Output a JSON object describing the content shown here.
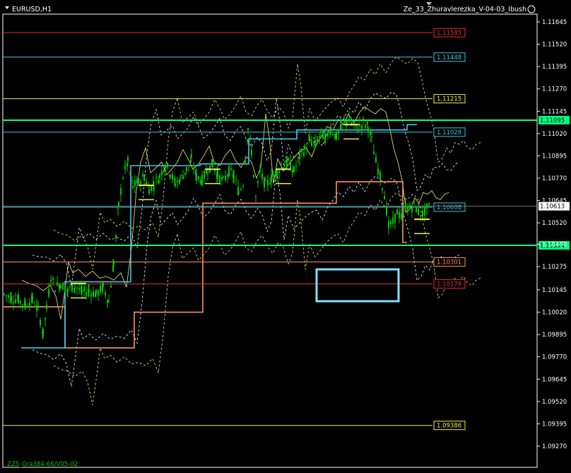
{
  "window": {
    "symbol_title": "EURUSD,H1",
    "indicator_title": "Ze_33_Zhuravlerezka_V-04-03_Ibush",
    "bottom_label": "ZZ5_Gra384-66/V05-02"
  },
  "colors": {
    "background": "#000000",
    "axis": "#ffffff",
    "candle": "#00c800",
    "red_level": "#e03030",
    "cyan_level": "#40c8e0",
    "yellow_level": "#f0f040",
    "green_level": "#00ff80",
    "orange_step": "#ff9060",
    "cyan_step": "#40c8e8",
    "envelope": "#ffffff",
    "ma_yellow": "#f0f080",
    "box": "#80e0ff"
  },
  "chart_data": {
    "type": "candlestick",
    "symbol": "EURUSD",
    "timeframe": "H1",
    "y_axis_ticks": [
      1.11645,
      1.1152,
      1.11395,
      1.1127,
      1.11145,
      1.1102,
      1.10895,
      1.1077,
      1.10645,
      1.1052,
      1.104,
      1.10275,
      1.10145,
      1.1002,
      1.09895,
      1.0977,
      1.09645,
      1.0952,
      1.09395,
      1.0927
    ],
    "horizontal_levels": [
      {
        "value": 1.11585,
        "label": "1.11585",
        "style": "red"
      },
      {
        "value": 1.11448,
        "label": "1.11448",
        "style": "cyan"
      },
      {
        "value": 1.11215,
        "label": "1.11215",
        "style": "yellow"
      },
      {
        "value": 1.11095,
        "label": "1.11095",
        "style": "green-highlight"
      },
      {
        "value": 1.11028,
        "label": "1.11028",
        "style": "cyan"
      },
      {
        "value": 1.10608,
        "label": "1.10608",
        "style": "cyan"
      },
      {
        "value": 1.10613,
        "label": "1.10613",
        "style": "current-price"
      },
      {
        "value": 1.10394,
        "label": "1.10394",
        "style": "green-highlight"
      },
      {
        "value": 1.10301,
        "label": "1.10301",
        "style": "orange"
      },
      {
        "value": 1.10178,
        "label": "1.10178",
        "style": "red"
      },
      {
        "value": 1.09386,
        "label": "1.09386",
        "style": "yellow"
      }
    ],
    "price_close_path": [
      [
        0,
        1.1012
      ],
      [
        10,
        1.101
      ],
      [
        20,
        1.1009
      ],
      [
        30,
        1.1006
      ],
      [
        40,
        1.1009
      ],
      [
        48,
        1.1003
      ],
      [
        55,
        1.099
      ],
      [
        60,
        1.1004
      ],
      [
        66,
        1.1022
      ],
      [
        72,
        1.1016
      ],
      [
        80,
        1.1018
      ],
      [
        90,
        1.1014
      ],
      [
        100,
        1.1017
      ],
      [
        110,
        1.1013
      ],
      [
        120,
        1.1014
      ],
      [
        130,
        1.1012
      ],
      [
        140,
        1.1016
      ],
      [
        148,
        1.1008
      ],
      [
        155,
        1.103
      ],
      [
        162,
        1.1062
      ],
      [
        168,
        1.1078
      ],
      [
        175,
        1.1086
      ],
      [
        182,
        1.1072
      ],
      [
        190,
        1.1075
      ],
      [
        198,
        1.1078
      ],
      [
        205,
        1.1071
      ],
      [
        212,
        1.1074
      ],
      [
        220,
        1.1078
      ],
      [
        228,
        1.1085
      ],
      [
        235,
        1.108
      ],
      [
        242,
        1.1074
      ],
      [
        250,
        1.1077
      ],
      [
        258,
        1.1082
      ],
      [
        265,
        1.1087
      ],
      [
        272,
        1.1078
      ],
      [
        280,
        1.1076
      ],
      [
        288,
        1.1082
      ],
      [
        295,
        1.1085
      ],
      [
        302,
        1.1079
      ],
      [
        310,
        1.1075
      ],
      [
        318,
        1.1081
      ],
      [
        325,
        1.1078
      ],
      [
        332,
        1.1069
      ],
      [
        338,
        1.1075
      ],
      [
        345,
        1.1105
      ],
      [
        350,
        1.1092
      ],
      [
        356,
        1.1066
      ],
      [
        362,
        1.108
      ],
      [
        370,
        1.1073
      ],
      [
        378,
        1.1077
      ],
      [
        386,
        1.1081
      ],
      [
        394,
        1.1084
      ],
      [
        402,
        1.1086
      ],
      [
        410,
        1.1081
      ],
      [
        418,
        1.1089
      ],
      [
        425,
        1.1093
      ],
      [
        432,
        1.1098
      ],
      [
        440,
        1.1096
      ],
      [
        448,
        1.1102
      ],
      [
        455,
        1.1099
      ],
      [
        462,
        1.1105
      ],
      [
        470,
        1.11
      ],
      [
        478,
        1.1106
      ],
      [
        485,
        1.1109
      ],
      [
        492,
        1.1107
      ],
      [
        500,
        1.1105
      ],
      [
        508,
        1.1108
      ],
      [
        515,
        1.1106
      ],
      [
        520,
        1.1098
      ],
      [
        526,
        1.1086
      ],
      [
        532,
        1.1078
      ],
      [
        538,
        1.1068
      ],
      [
        544,
        1.105
      ],
      [
        550,
        1.1052
      ],
      [
        556,
        1.1058
      ],
      [
        562,
        1.1055
      ],
      [
        568,
        1.1061
      ],
      [
        574,
        1.106
      ],
      [
        580,
        1.1062
      ],
      [
        586,
        1.1058
      ],
      [
        592,
        1.1057
      ],
      [
        598,
        1.106
      ],
      [
        604,
        1.1061
      ]
    ]
  }
}
